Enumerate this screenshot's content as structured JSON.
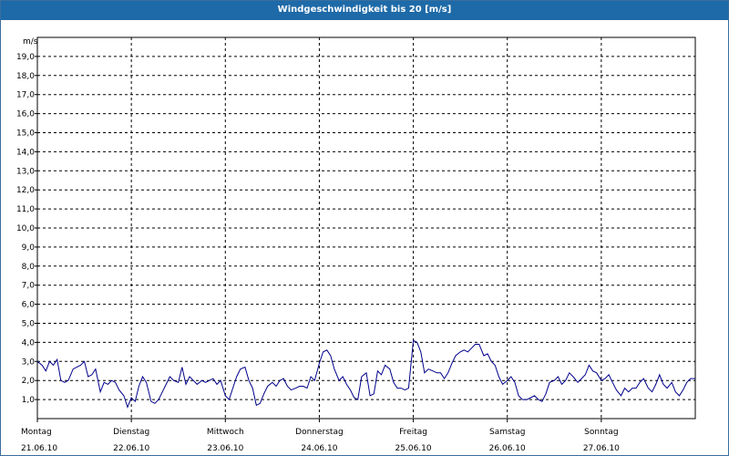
{
  "chart_data": {
    "type": "line",
    "title": "Windgeschwindigkeit bis 20 [m/s]",
    "ylabel": "m/s",
    "ylim": [
      0,
      20
    ],
    "y_ticks": [
      "1,0",
      "2,0",
      "3,0",
      "4,0",
      "5,0",
      "6,0",
      "7,0",
      "8,0",
      "9,0",
      "10,0",
      "11,0",
      "12,0",
      "13,0",
      "14,0",
      "15,0",
      "16,0",
      "17,0",
      "18,0",
      "19,0"
    ],
    "x_range_days": [
      0,
      7
    ],
    "x_ticks": [
      {
        "day": "Montag",
        "date": "21.06.10"
      },
      {
        "day": "Dienstag",
        "date": "22.06.10"
      },
      {
        "day": "Mittwoch",
        "date": "23.06.10"
      },
      {
        "day": "Donnerstag",
        "date": "24.06.10"
      },
      {
        "day": "Freitag",
        "date": "25.06.10"
      },
      {
        "day": "Samstag",
        "date": "26.06.10"
      },
      {
        "day": "Sonntag",
        "date": "27.06.10"
      }
    ],
    "grid": true,
    "line_color": "#00008b",
    "series": [
      {
        "x": [
          0.0,
          0.05,
          0.09,
          0.13,
          0.17,
          0.21,
          0.25,
          0.29,
          0.33,
          0.38,
          0.42,
          0.46,
          0.5,
          0.54,
          0.58,
          0.62,
          0.67,
          0.71,
          0.75,
          0.79,
          0.83,
          0.87,
          0.92,
          0.96,
          1.0,
          1.04,
          1.08,
          1.12,
          1.16,
          1.21,
          1.25,
          1.29,
          1.33,
          1.37,
          1.41,
          1.45,
          1.5,
          1.54,
          1.58,
          1.62,
          1.66,
          1.7,
          1.75,
          1.79,
          1.83,
          1.87,
          1.91,
          1.95,
          2.0,
          2.04,
          2.08,
          2.12,
          2.16,
          2.21,
          2.25,
          2.29,
          2.33,
          2.37,
          2.41,
          2.45,
          2.5,
          2.54,
          2.58,
          2.62,
          2.66,
          2.7,
          2.75,
          2.79,
          2.83,
          2.87,
          2.91,
          2.95,
          3.0,
          3.04,
          3.08,
          3.12,
          3.16,
          3.21,
          3.25,
          3.29,
          3.33,
          3.37,
          3.41,
          3.45,
          3.5,
          3.54,
          3.58,
          3.62,
          3.66,
          3.7,
          3.75,
          3.79,
          3.83,
          3.87,
          3.91,
          3.95,
          4.0,
          4.04,
          4.08,
          4.12,
          4.16,
          4.21,
          4.25,
          4.29,
          4.33,
          4.37,
          4.41,
          4.45,
          4.5,
          4.54,
          4.58,
          4.62,
          4.66,
          4.7,
          4.75,
          4.79,
          4.83,
          4.87,
          4.91,
          4.95,
          5.0,
          5.04,
          5.08,
          5.12,
          5.16,
          5.21,
          5.25,
          5.29,
          5.33,
          5.37,
          5.41,
          5.45,
          5.5,
          5.54,
          5.58,
          5.62,
          5.66,
          5.7,
          5.75,
          5.79,
          5.83,
          5.87,
          5.91,
          5.95,
          6.0,
          6.04,
          6.08,
          6.12,
          6.16,
          6.21,
          6.25,
          6.29,
          6.33,
          6.37,
          6.41,
          6.45,
          6.5,
          6.54,
          6.58,
          6.62,
          6.66,
          6.7,
          6.75,
          6.79,
          6.83,
          6.87,
          6.91,
          6.95,
          7.0
        ],
        "values": [
          3.0,
          2.8,
          2.5,
          3.0,
          2.8,
          3.1,
          2.0,
          1.9,
          2.0,
          2.6,
          2.7,
          2.8,
          3.0,
          2.2,
          2.3,
          2.6,
          1.4,
          1.9,
          1.8,
          2.0,
          1.9,
          1.5,
          1.2,
          0.6,
          1.1,
          0.9,
          1.7,
          2.2,
          1.9,
          0.9,
          0.8,
          1.0,
          1.4,
          1.8,
          2.2,
          2.0,
          1.9,
          2.7,
          1.8,
          2.2,
          2.0,
          1.8,
          2.0,
          1.9,
          2.0,
          2.1,
          1.8,
          2.0,
          1.2,
          1.0,
          1.6,
          2.2,
          2.6,
          2.7,
          2.0,
          1.6,
          0.7,
          0.8,
          1.3,
          1.7,
          1.9,
          1.7,
          2.0,
          2.1,
          1.7,
          1.5,
          1.6,
          1.7,
          1.7,
          1.6,
          2.2,
          2.0,
          2.9,
          3.5,
          3.6,
          3.3,
          2.6,
          2.0,
          2.2,
          1.8,
          1.5,
          1.1,
          1.0,
          2.2,
          2.4,
          1.2,
          1.3,
          2.5,
          2.3,
          2.8,
          2.6,
          1.9,
          1.6,
          1.6,
          1.5,
          1.6,
          4.1,
          4.0,
          3.5,
          2.4,
          2.6,
          2.5,
          2.4,
          2.4,
          2.1,
          2.4,
          2.9,
          3.3,
          3.5,
          3.6,
          3.5,
          3.7,
          3.9,
          3.9,
          3.3,
          3.4,
          3.0,
          2.8,
          2.2,
          1.8,
          2.0,
          2.2,
          1.9,
          1.2,
          1.0,
          1.0,
          1.1,
          1.2,
          1.0,
          0.9,
          1.3,
          1.9,
          2.0,
          2.2,
          1.8,
          2.0,
          2.4,
          2.2,
          1.9,
          2.1,
          2.3,
          2.8,
          2.5,
          2.4,
          2.0,
          2.1,
          2.3,
          1.9,
          1.5,
          1.2,
          1.6,
          1.4,
          1.6,
          1.6,
          1.9,
          2.1,
          1.6,
          1.4,
          1.8,
          2.3,
          1.8,
          1.6,
          1.9,
          1.4,
          1.2,
          1.5,
          1.9,
          2.1,
          2.1
        ]
      }
    ]
  }
}
